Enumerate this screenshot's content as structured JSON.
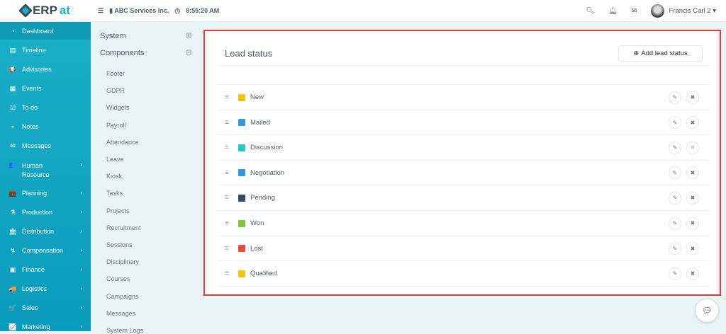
{
  "brand": {
    "name_a": "ERP",
    "name_b": "at"
  },
  "topbar": {
    "company": "ABC Services Inc.",
    "time": "8:55:20 AM",
    "user": "Francis Carl 2"
  },
  "sidebar": {
    "items": [
      {
        "label": "Dashboard",
        "icon": "◔",
        "chev": false
      },
      {
        "label": "Timeline",
        "icon": "▤",
        "chev": false
      },
      {
        "label": "Advisories",
        "icon": "📢",
        "chev": false
      },
      {
        "label": "Events",
        "icon": "▦",
        "chev": false
      },
      {
        "label": "To do",
        "icon": "☑",
        "chev": false
      },
      {
        "label": "Notes",
        "icon": "▪",
        "chev": false
      },
      {
        "label": "Messages",
        "icon": "✉",
        "chev": false
      },
      {
        "label": "Human Resource",
        "icon": "👥",
        "chev": true
      },
      {
        "label": "Planning",
        "icon": "💼",
        "chev": true
      },
      {
        "label": "Production",
        "icon": "⚗",
        "chev": true
      },
      {
        "label": "Distribution",
        "icon": "🏛",
        "chev": true
      },
      {
        "label": "Compensation",
        "icon": "↯",
        "chev": true
      },
      {
        "label": "Finance",
        "icon": "▣",
        "chev": true
      },
      {
        "label": "Logistics",
        "icon": "🚚",
        "chev": true
      },
      {
        "label": "Sales",
        "icon": "🛒",
        "chev": true
      },
      {
        "label": "Marketing",
        "icon": "📈",
        "chev": true
      }
    ]
  },
  "settings": {
    "system": "System",
    "components": "Components",
    "items": [
      "Footer",
      "GDPR",
      "Widgets",
      "Payroll",
      "Attendance",
      "Leave",
      "Kiosk",
      "Tasks",
      "Projects",
      "Recruitment",
      "Sessions",
      "Disciplinary",
      "Courses",
      "Campaigns",
      "Messages",
      "System Logs"
    ]
  },
  "main": {
    "title": "Lead status",
    "add_label": "Add lead status",
    "statuses": [
      {
        "label": "New",
        "color": "#f1c40f",
        "delete_enabled": true
      },
      {
        "label": "Mailed",
        "color": "#3498db",
        "delete_enabled": true
      },
      {
        "label": "Discussion",
        "color": "#2ec4c4",
        "delete_enabled": false
      },
      {
        "label": "Negotiation",
        "color": "#3498db",
        "delete_enabled": true
      },
      {
        "label": "Pending",
        "color": "#34495e",
        "delete_enabled": true
      },
      {
        "label": "Won",
        "color": "#83c340",
        "delete_enabled": true
      },
      {
        "label": "Lost",
        "color": "#e74c3c",
        "delete_enabled": true
      },
      {
        "label": "Qualified",
        "color": "#f1c40f",
        "delete_enabled": true
      }
    ]
  }
}
